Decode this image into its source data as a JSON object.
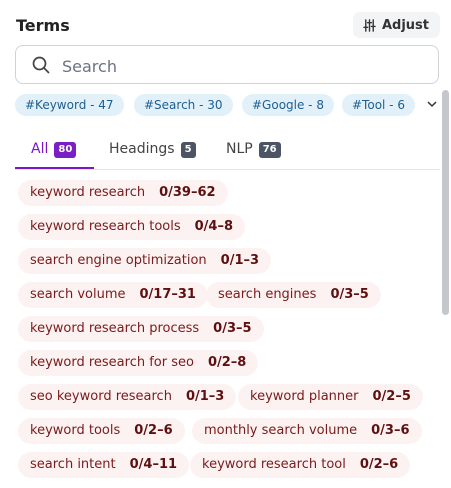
{
  "header": {
    "title": "Terms",
    "adjust_label": "Adjust"
  },
  "search": {
    "placeholder": "Search",
    "value": ""
  },
  "hashtags": [
    "#Keyword - 47",
    "#Search - 30",
    "#Google - 8",
    "#Tool - 6"
  ],
  "tabs": [
    {
      "label": "All",
      "count": "80",
      "active": true
    },
    {
      "label": "Headings",
      "count": "5",
      "active": false
    },
    {
      "label": "NLP",
      "count": "76",
      "active": false
    }
  ],
  "terms": [
    {
      "label": "keyword research",
      "count": "0/39–62"
    },
    {
      "label": "keyword research tools",
      "count": "0/4–8"
    },
    {
      "label": "search engine optimization",
      "count": "0/1–3"
    },
    {
      "label": "search volume",
      "count": "0/17–31"
    },
    {
      "label": "search engines",
      "count": "0/3–5"
    },
    {
      "label": "keyword research process",
      "count": "0/3–5"
    },
    {
      "label": "keyword research for seo",
      "count": "0/2–8"
    },
    {
      "label": "seo keyword research",
      "count": "0/1–3"
    },
    {
      "label": "keyword planner",
      "count": "0/2–5"
    },
    {
      "label": "keyword tools",
      "count": "0/2–6"
    },
    {
      "label": "monthly search volume",
      "count": "0/3–6"
    },
    {
      "label": "search intent",
      "count": "0/4–11"
    },
    {
      "label": "keyword research tool",
      "count": "0/2–6"
    }
  ],
  "colors": {
    "accent": "#7a16c2",
    "hashtag_bg": "#e2f0fa",
    "chip_bg": "#fdf2f2"
  },
  "icons": {
    "adjust": "sliders-icon",
    "search": "search-icon",
    "expand": "chevron-down-icon"
  }
}
